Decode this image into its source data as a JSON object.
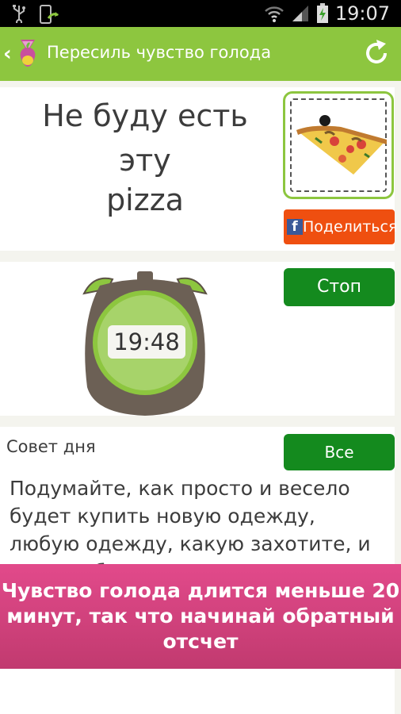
{
  "status_bar": {
    "time": "19:07"
  },
  "app_bar": {
    "title": "Пересиль чувство голода",
    "back_glyph": "‹"
  },
  "food_card": {
    "lines": [
      "Не буду есть",
      "эту",
      "pizza"
    ],
    "share_label": "Поделиться",
    "share_icon": "facebook-icon"
  },
  "timer_card": {
    "time": "19:48",
    "stop_label": "Стоп"
  },
  "tip_card": {
    "title": "Совет дня",
    "all_label": "Все",
    "body": "Подумайте, как просто и весело будет купить новую одежду, любую одежду, какую захотите, и вся она будет потрясающе выглядеть на вас!"
  },
  "banner": {
    "text": "Чувство голода длится меньше 20 минут, так что начинай обратный отсчет"
  },
  "colors": {
    "accent": "#8dc63f",
    "share": "#ef4f10",
    "button_green": "#148a1e",
    "banner": "#d6437e"
  }
}
